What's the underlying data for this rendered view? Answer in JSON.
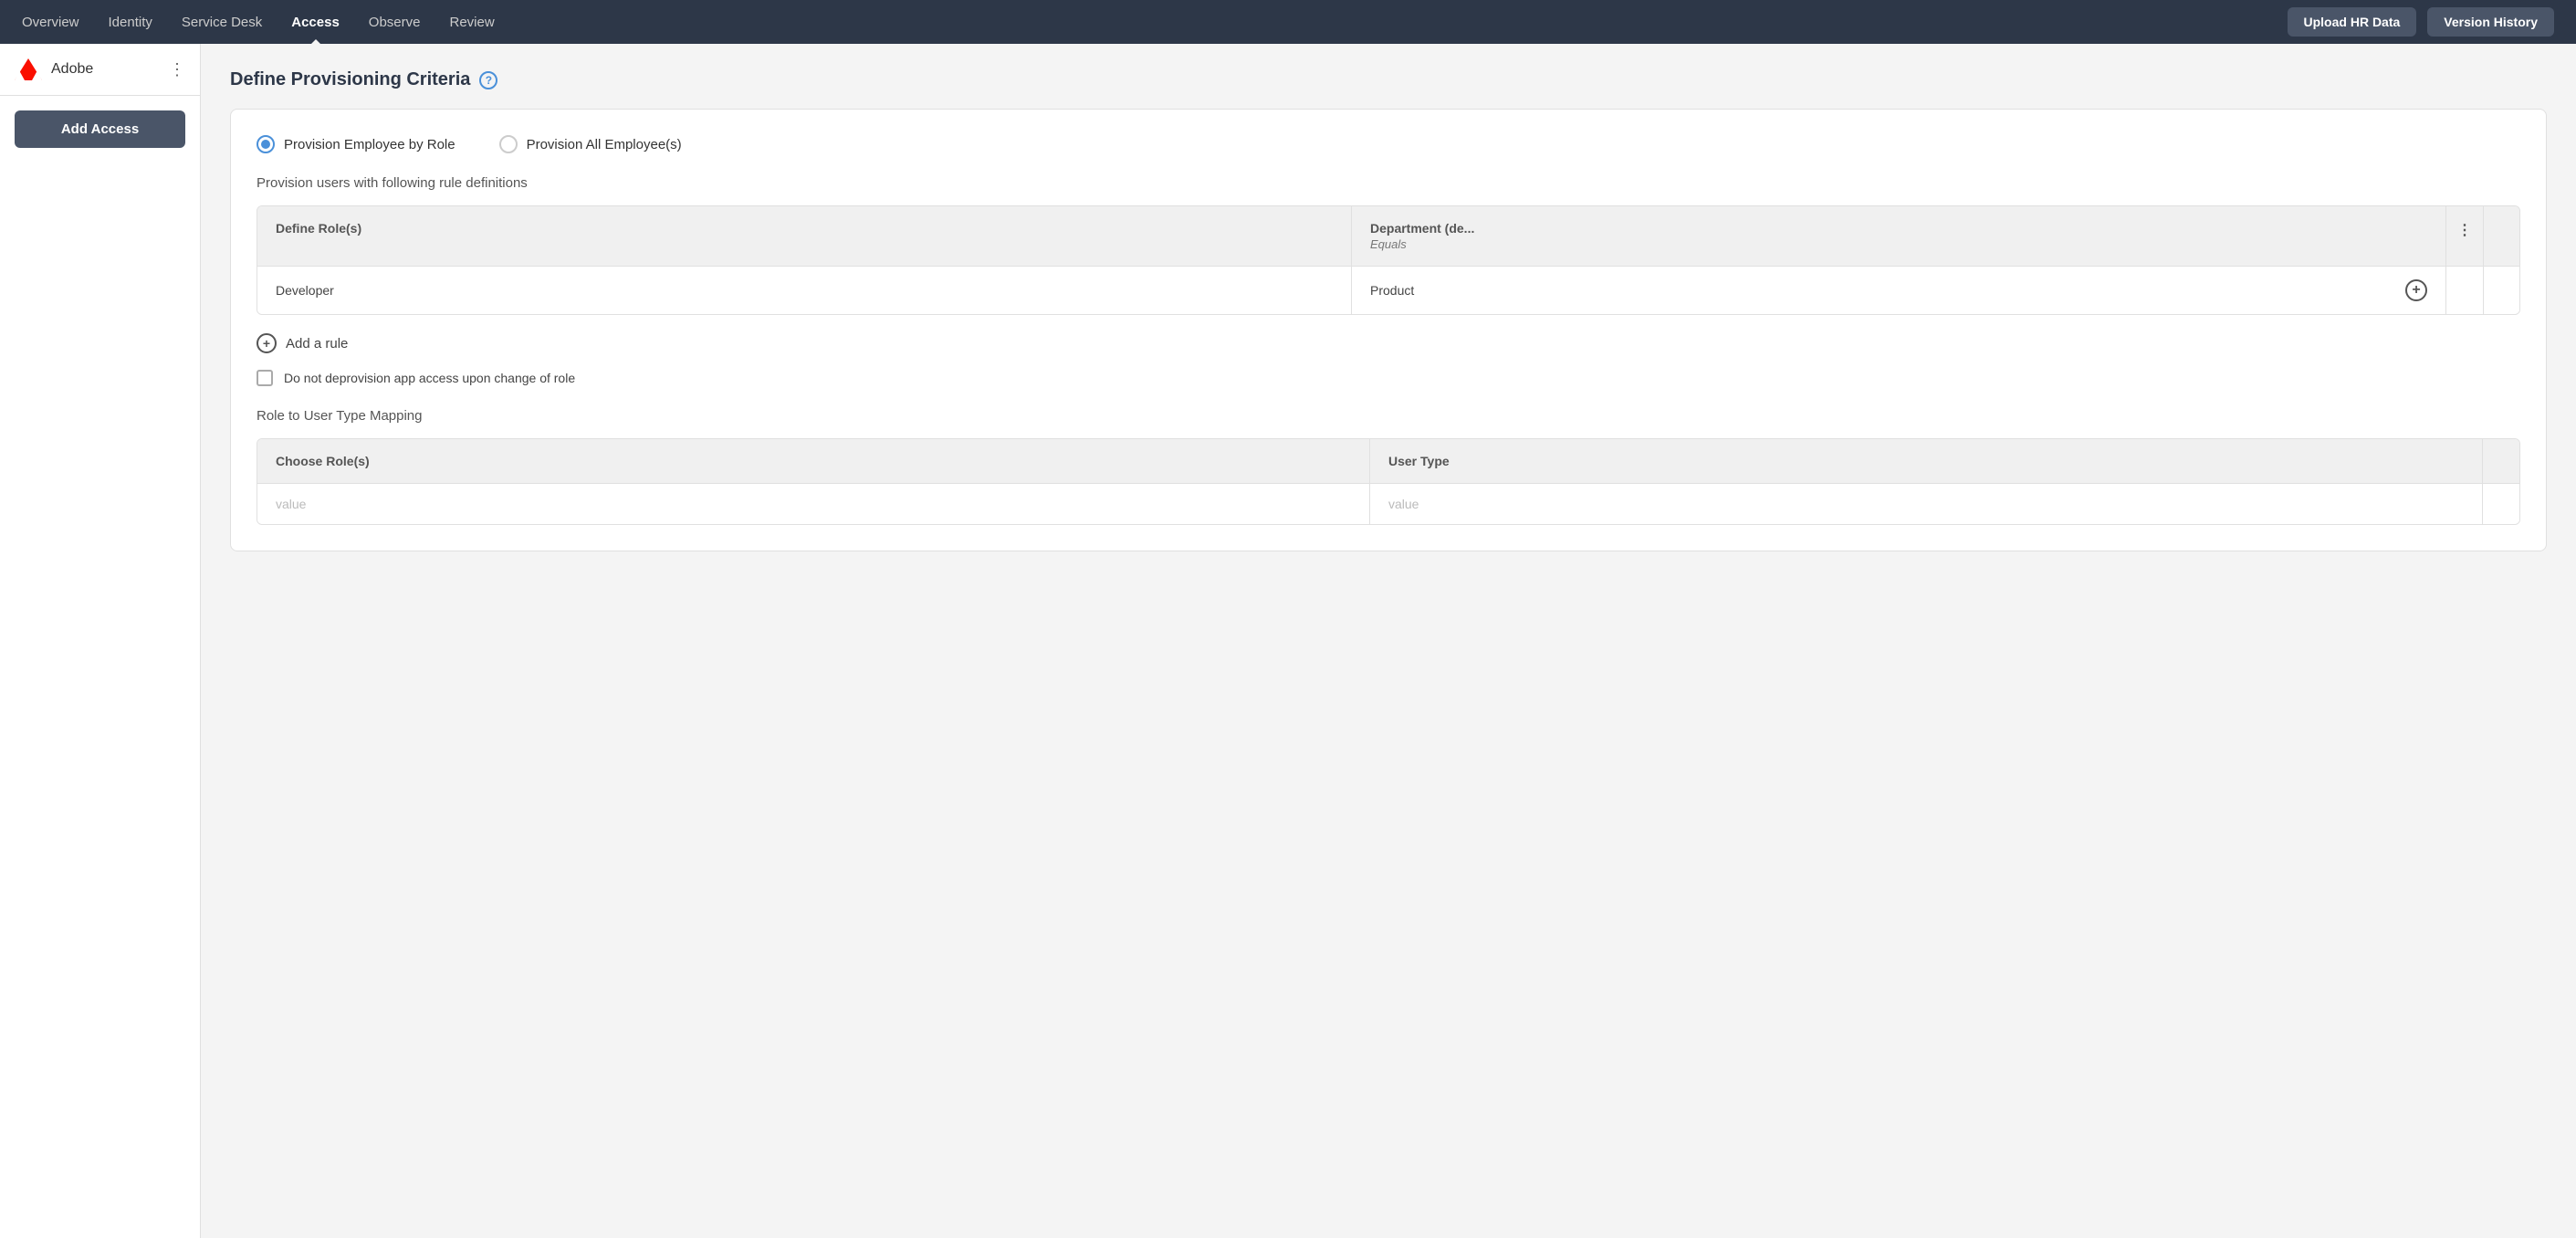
{
  "nav": {
    "items": [
      {
        "label": "Overview",
        "active": false
      },
      {
        "label": "Identity",
        "active": false
      },
      {
        "label": "Service Desk",
        "active": false
      },
      {
        "label": "Access",
        "active": true
      },
      {
        "label": "Observe",
        "active": false
      },
      {
        "label": "Review",
        "active": false
      }
    ],
    "upload_hr_data": "Upload HR Data",
    "version_history": "Version History"
  },
  "sidebar": {
    "app_name": "Adobe",
    "add_access": "Add Access"
  },
  "main": {
    "page_title": "Define Provisioning Criteria",
    "help_icon": "?",
    "radio_options": [
      {
        "label": "Provision Employee by Role",
        "selected": true
      },
      {
        "label": "Provision All Employee(s)",
        "selected": false
      }
    ],
    "rule_description": "Provision users with following rule definitions",
    "rule_table": {
      "columns": [
        {
          "label": "Define Role(s)"
        },
        {
          "label": "Department (de...",
          "sub": "Equals"
        },
        {
          "label": ""
        },
        {
          "label": ""
        }
      ],
      "rows": [
        {
          "role": "Developer",
          "department": "Product"
        }
      ]
    },
    "add_rule_label": "Add a rule",
    "checkbox_label": "Do not deprovision app access upon change of role",
    "mapping_section_label": "Role to User Type Mapping",
    "mapping_table": {
      "columns": [
        {
          "label": "Choose Role(s)"
        },
        {
          "label": "User Type"
        },
        {
          "label": ""
        }
      ],
      "rows": [
        {
          "role_value": "value",
          "user_type_value": "value"
        }
      ]
    }
  }
}
